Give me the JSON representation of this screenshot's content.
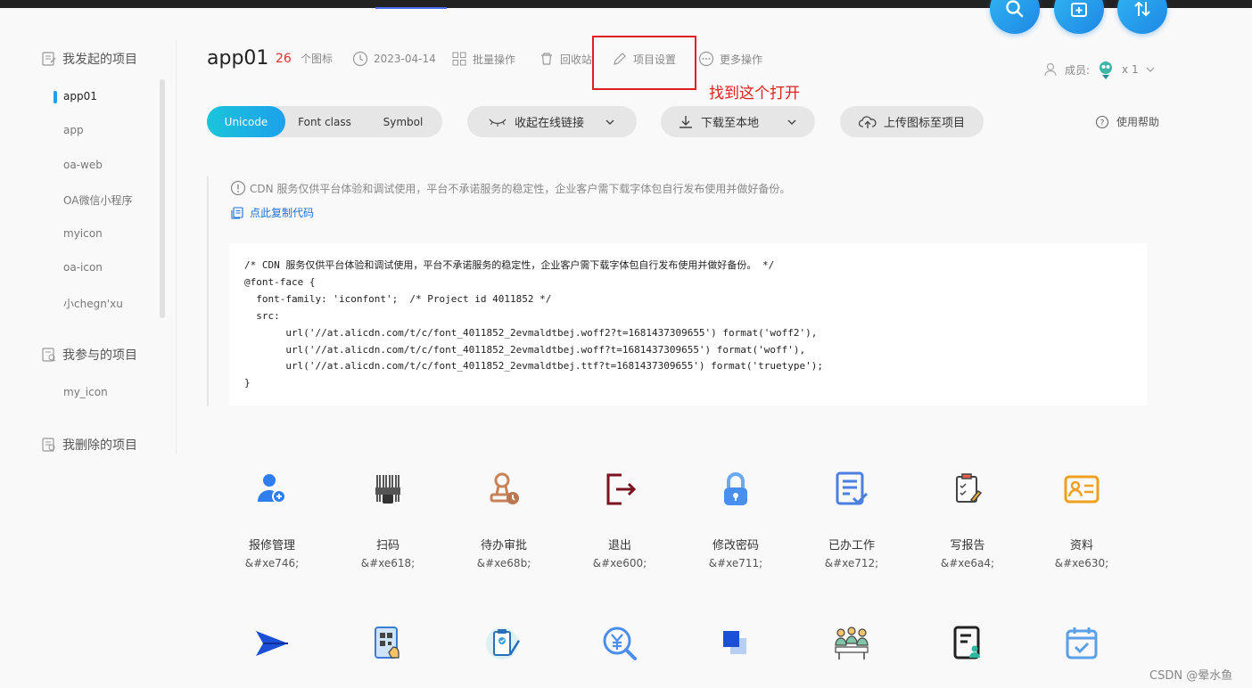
{
  "project": {
    "name": "app01",
    "icon_count": "26",
    "icon_count_label": "个图标",
    "date": "2023-04-14"
  },
  "header_actions": {
    "batch": "批量操作",
    "recycle": "回收站",
    "settings": "项目设置",
    "more": "更多操作"
  },
  "annotation": "找到这个打开",
  "members": {
    "label": "成员:",
    "count": "x 1"
  },
  "sidebar": {
    "my_projects": "我发起的项目",
    "items": [
      "app01",
      "app",
      "oa-web",
      "OA微信小程序",
      "myicon",
      "oa-icon",
      "小chegn'xu"
    ],
    "joined_projects": "我参与的项目",
    "joined_items": [
      "my_icon"
    ],
    "deleted_projects": "我删除的项目"
  },
  "toolbar": {
    "tabs": [
      "Unicode",
      "Font class",
      "Symbol"
    ],
    "collapse_link": "收起在线链接",
    "download": "下载至本地",
    "upload": "上传图标至项目",
    "help": "使用帮助"
  },
  "notice": "CDN 服务仅供平台体验和调试使用，平台不承诺服务的稳定性，企业客户需下载字体包自行发布使用并做好备份。",
  "copy_code": "点此复制代码",
  "code_lines": [
    "/* CDN 服务仅供平台体验和调试使用，平台不承诺服务的稳定性，企业客户需下载字体包自行发布使用并做好备份。 */",
    "@font-face {",
    "  font-family: 'iconfont';  /* Project id 4011852 */",
    "  src:",
    "       url('//at.alicdn.com/t/c/font_4011852_2evmaldtbej.woff2?t=1681437309655') format('woff2'),",
    "       url('//at.alicdn.com/t/c/font_4011852_2evmaldtbej.woff?t=1681437309655') format('woff'),",
    "       url('//at.alicdn.com/t/c/font_4011852_2evmaldtbej.ttf?t=1681437309655') format('truetype');",
    "}"
  ],
  "icons": [
    {
      "name": "报修管理",
      "code": "&#xe746;",
      "icon": "repair-user-icon"
    },
    {
      "name": "扫码",
      "code": "&#xe618;",
      "icon": "barcode-scan-icon"
    },
    {
      "name": "待办审批",
      "code": "&#xe68b;",
      "icon": "approval-stamp-icon"
    },
    {
      "name": "退出",
      "code": "&#xe600;",
      "icon": "logout-icon"
    },
    {
      "name": "修改密码",
      "code": "&#xe711;",
      "icon": "padlock-icon"
    },
    {
      "name": "已办工作",
      "code": "&#xe712;",
      "icon": "done-list-icon"
    },
    {
      "name": "写报告",
      "code": "&#xe6a4;",
      "icon": "write-report-icon"
    },
    {
      "name": "资料",
      "code": "&#xe630;",
      "icon": "id-card-icon"
    }
  ],
  "icons_row2": [
    "paper-plane-icon",
    "phone-qr-icon",
    "clipboard-pen-icon",
    "yuan-search-icon",
    "layers-icon",
    "team-meeting-icon",
    "document-user-icon",
    "calendar-check-icon"
  ],
  "watermark": "CSDN @晕水鱼",
  "colors": {
    "accent": "#1da0ed",
    "annotation": "#e02020",
    "count": "#e02d2d"
  }
}
